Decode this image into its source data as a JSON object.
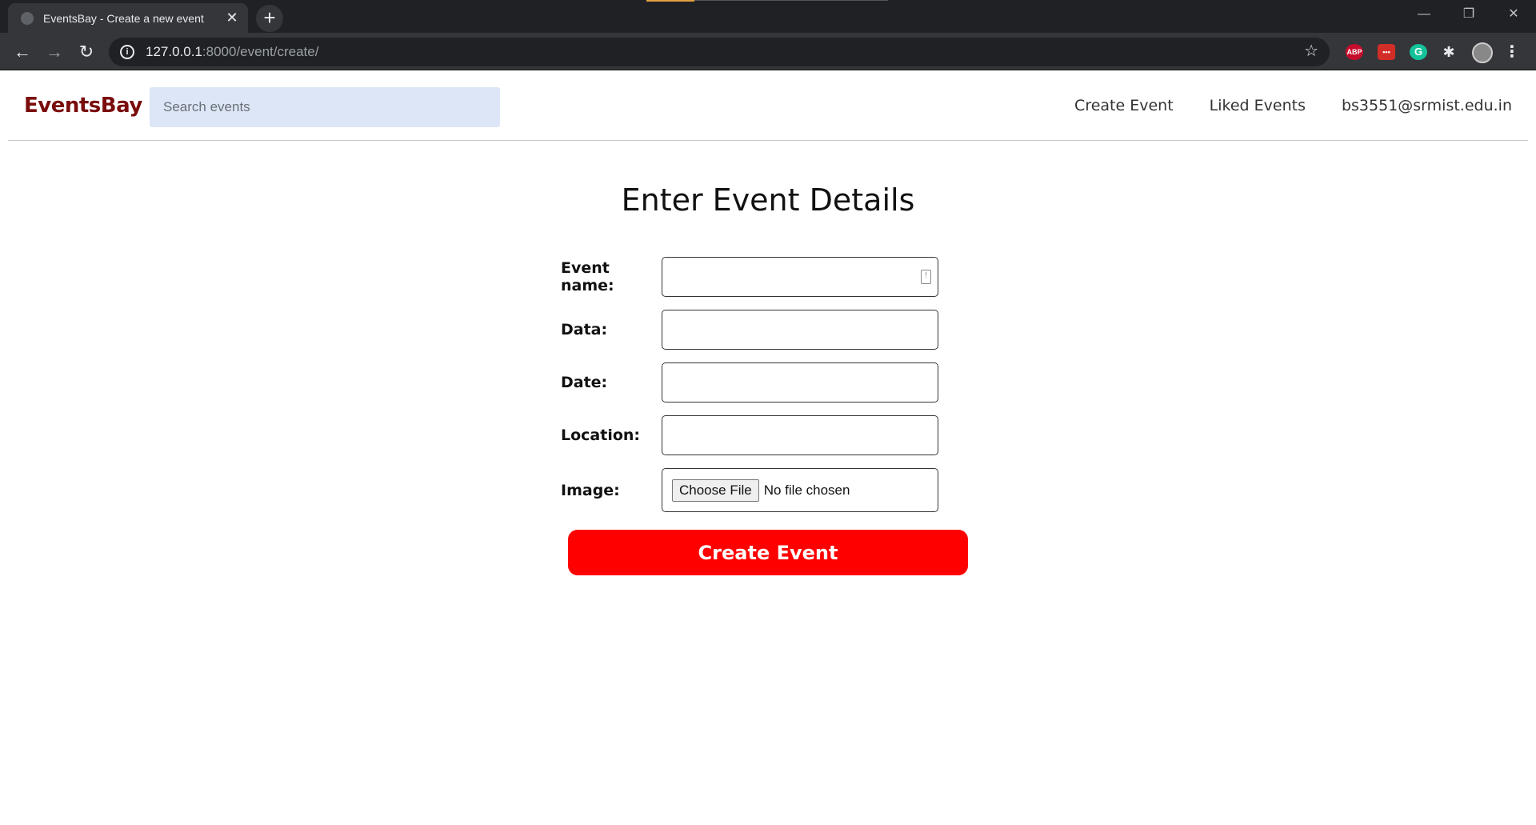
{
  "browser": {
    "tab_title": "EventsBay - Create a new event",
    "tab_close": "✕",
    "new_tab": "+",
    "url_host": "127.0.0.1",
    "url_path": ":8000/event/create/",
    "window_minimize": "—",
    "window_restore": "❐",
    "window_close": "✕",
    "extensions": {
      "abp": "ABP",
      "lastpass": "•••",
      "grammarly": "G"
    }
  },
  "navbar": {
    "brand": "EventsBay",
    "search_placeholder": "Search events",
    "links": [
      "Create Event",
      "Liked Events",
      "bs3551@srmist.edu.in"
    ]
  },
  "form": {
    "heading": "Enter Event Details",
    "fields": [
      {
        "label": "Event name:",
        "value": ""
      },
      {
        "label": "Data:",
        "value": ""
      },
      {
        "label": "Date:",
        "value": ""
      },
      {
        "label": "Location:",
        "value": ""
      }
    ],
    "image_label": "Image:",
    "choose_file_label": "Choose File",
    "file_status": "No file chosen",
    "submit_label": "Create Event"
  },
  "colors": {
    "brand": "#7a0c0c",
    "submit_bg": "#ff0000",
    "search_bg": "#dce6f7"
  }
}
